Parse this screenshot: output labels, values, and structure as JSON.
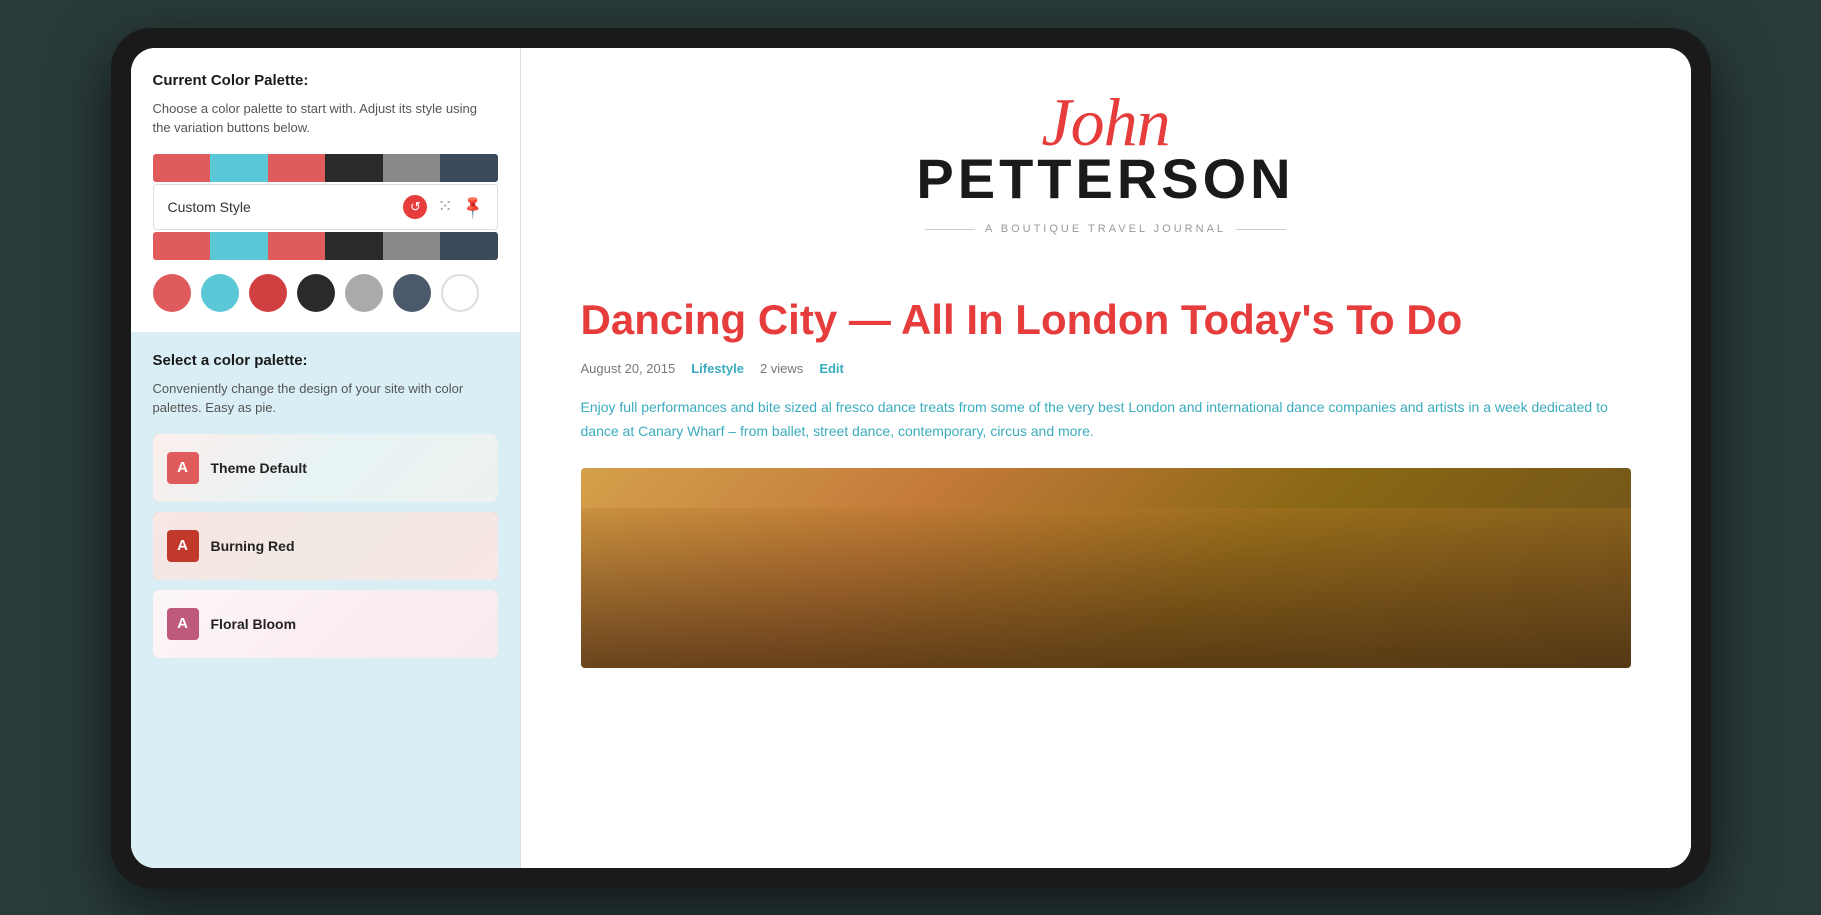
{
  "panel": {
    "title": "Current Color Palette:",
    "description": "Choose a color palette to start with. Adjust its style using the variation buttons below.",
    "custom_style_label": "Custom Style",
    "color_bar_segments": [
      "#e05c5c",
      "#5bc8d8",
      "#e05c5c",
      "#2a2a2a",
      "#888",
      "#3a4a5a"
    ],
    "color_dots": [
      {
        "color": "#e05c5c",
        "name": "red-dot"
      },
      {
        "color": "#5bc8d8",
        "name": "cyan-dot"
      },
      {
        "color": "#d04040",
        "name": "dark-red-dot"
      },
      {
        "color": "#2a2a2a",
        "name": "black-dot"
      },
      {
        "color": "#aaaaaa",
        "name": "gray-dot"
      },
      {
        "color": "#4a5a6a",
        "name": "dark-blue-dot"
      },
      {
        "color": "#ffffff",
        "name": "white-dot"
      }
    ],
    "select_title": "Select a color palette:",
    "select_desc": "Conveniently change the design of your site with color palettes. Easy as pie.",
    "palettes": [
      {
        "id": "default",
        "letter": "A",
        "name": "Theme Default",
        "letter_bg": "#e05c5c",
        "bg_class": "palette-bg-default"
      },
      {
        "id": "burning",
        "letter": "A",
        "name": "Burning Red",
        "letter_bg": "#c0392b",
        "bg_class": "palette-bg-burning"
      },
      {
        "id": "floral",
        "letter": "A",
        "name": "Floral Bloom",
        "letter_bg": "#c05a7a",
        "bg_class": "palette-bg-floral"
      }
    ]
  },
  "blog": {
    "name_script": "John",
    "name_bold": "PETTERSON",
    "tagline": "A BOUTIQUE TRAVEL JOURNAL",
    "article_title": "Dancing City — All In London Today's To Do",
    "meta_date": "August 20, 2015",
    "meta_category": "Lifestyle",
    "meta_views": "2 views",
    "meta_edit": "Edit",
    "excerpt": "Enjoy full performances and bite sized al fresco dance treats from some of the very best London and international dance companies and artists in a week dedicated to dance at Canary Wharf – from ballet, street dance, contemporary, circus and more."
  }
}
